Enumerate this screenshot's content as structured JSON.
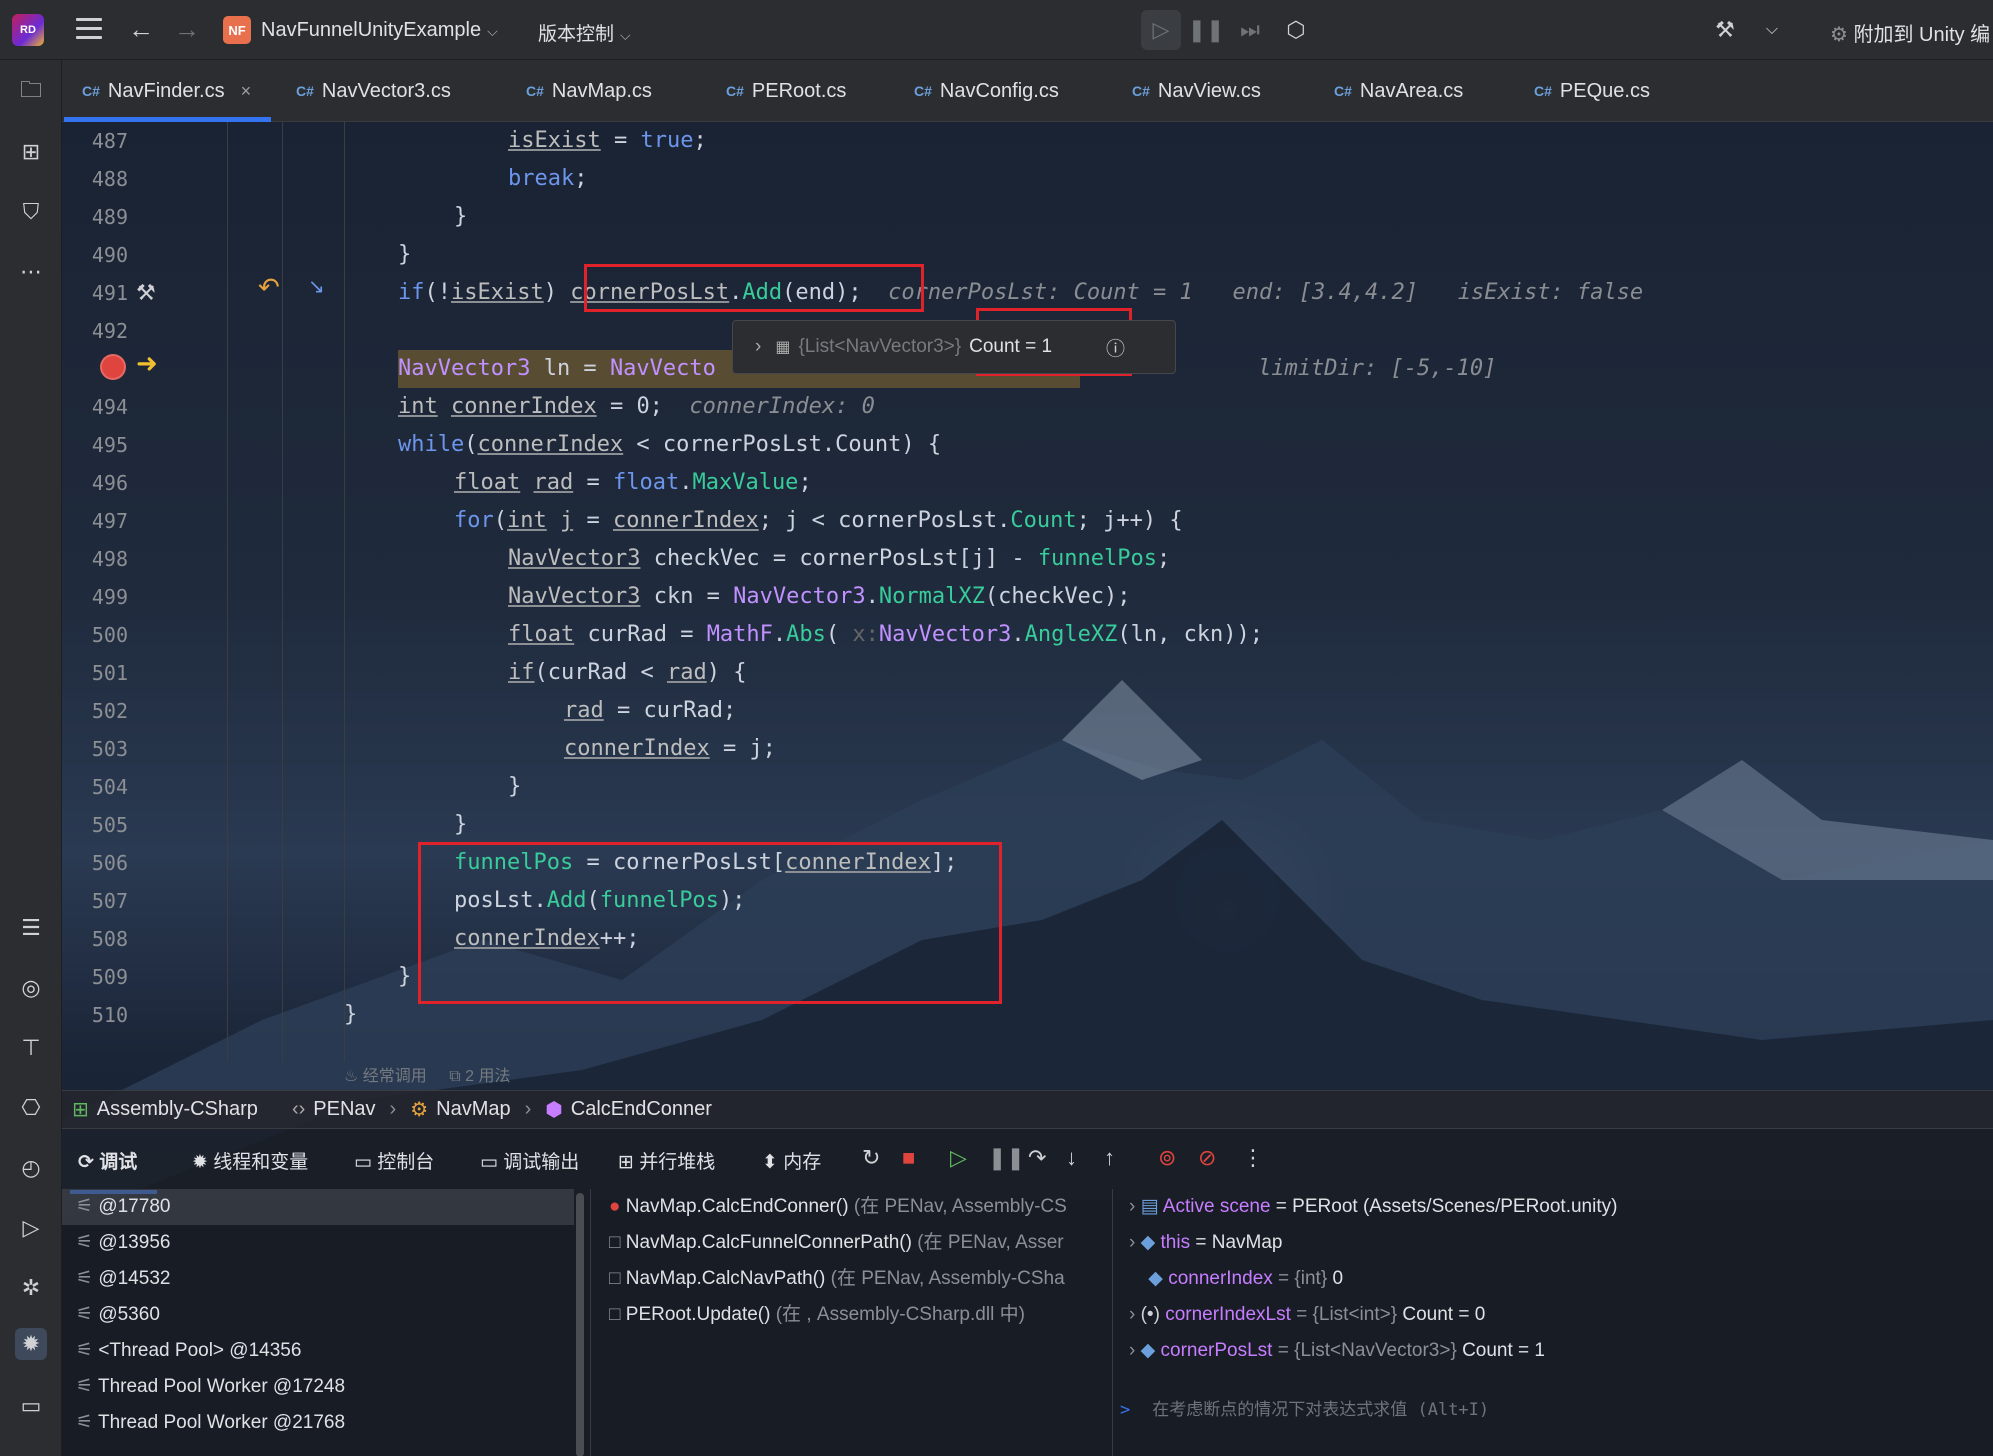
{
  "app": {
    "logo_text": "RD",
    "project_badge": "NF",
    "project_name": "NavFunnelUnityExample",
    "vcs_label": "版本控制",
    "attach_label": "附加到 Unity 编"
  },
  "tabs": [
    {
      "label": "NavFinder.cs",
      "active": true
    },
    {
      "label": "NavVector3.cs"
    },
    {
      "label": "NavMap.cs"
    },
    {
      "label": "PERoot.cs"
    },
    {
      "label": "NavConfig.cs"
    },
    {
      "label": "NavView.cs"
    },
    {
      "label": "NavArea.cs"
    },
    {
      "label": "PEQue.cs"
    }
  ],
  "tab_lang": "C#",
  "editor": {
    "line_numbers": [
      "487",
      "488",
      "489",
      "490",
      "491",
      "492",
      "",
      "494",
      "495",
      "496",
      "497",
      "498",
      "499",
      "500",
      "501",
      "502",
      "503",
      "504",
      "505",
      "506",
      "507",
      "508",
      "509",
      "510"
    ],
    "hints": {
      "l491_a": "cornerPosLst: Count = 1",
      "l491_b": "end: [3.4,4.2]",
      "l491_c": "isExist: false",
      "l493": "limitDir: [-5,-10]",
      "l494": "connerIndex: 0"
    },
    "tooltip": {
      "type_text": "{List<NavVector3>}",
      "count_text": "Count = 1"
    },
    "inlay_usage": "经常调用",
    "inlay_refs": "2 用法"
  },
  "breadcrumb": [
    "Assembly-CSharp",
    "PENav",
    "NavMap",
    "CalcEndConner"
  ],
  "debug": {
    "tabs": [
      "调试",
      "线程和变量",
      "控制台",
      "调试输出",
      "并行堆栈",
      "内存"
    ],
    "threads": [
      "@17780",
      "@13956",
      "@14532",
      "@5360",
      "<Thread Pool> @14356",
      "Thread Pool Worker @17248",
      "Thread Pool Worker @21768"
    ],
    "frames": [
      {
        "method": "NavMap.CalcEndConner()",
        "loc": " (在 PENav, Assembly-CS"
      },
      {
        "method": "NavMap.CalcFunnelConnerPath()",
        "loc": " (在 PENav, Asser"
      },
      {
        "method": "NavMap.CalcNavPath()",
        "loc": " (在 PENav, Assembly-CSha"
      },
      {
        "method": "PERoot.Update()",
        "loc": " (在 , Assembly-CSharp.dll 中)"
      }
    ],
    "variables": [
      {
        "name": "Active scene",
        "rest": " = PERoot (Assets/Scenes/PERoot.unity)"
      },
      {
        "name": "this",
        "rest": " = NavMap"
      },
      {
        "name": "connerIndex",
        "type": " = {int} ",
        "value": "0"
      },
      {
        "name": "cornerIndexLst",
        "type": " = {List<int>} ",
        "value": "Count = 0"
      },
      {
        "name": "cornerPosLst",
        "type": " = {List<NavVector3>} ",
        "value": "Count = 1"
      }
    ],
    "eval_placeholder": "在考虑断点的情况下对表达式求值 (Alt+I)"
  }
}
